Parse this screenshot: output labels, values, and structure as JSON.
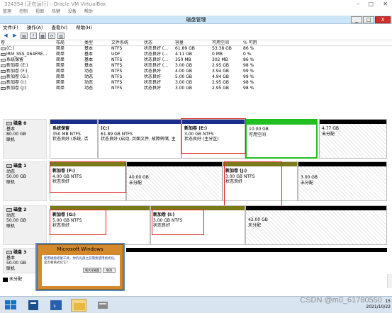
{
  "vbox": {
    "title": "324354 [正在运行] - Oracle VM VirtualBox",
    "menu": [
      "管理",
      "控制",
      "视图",
      "热键",
      "设备",
      "帮助"
    ]
  },
  "app": {
    "title": "磁盘管理",
    "controls": {
      "min": "_",
      "max": "□",
      "close": "X"
    },
    "menu": [
      "文件(F)",
      "操作(A)",
      "查看(V)",
      "帮助(H)"
    ]
  },
  "volume_table": {
    "headers": [
      "卷",
      "布局",
      "类型",
      "文件系统",
      "状态",
      "容量",
      "可用空间",
      "% 可用"
    ],
    "rows": [
      [
        "(C:)",
        "简单",
        "基本",
        "NTFS",
        "状态良好 (...",
        "61.89 GB",
        "53.38 GB",
        "86 %"
      ],
      [
        "IRM_SSS_X64FRE...",
        "简单",
        "基本",
        "UDF",
        "状态良好 (...",
        "4.11 GB",
        "0 MB",
        "0 %"
      ],
      [
        "系统保留",
        "简单",
        "基本",
        "NTFS",
        "状态良好 (...",
        "350 MB",
        "302 MB",
        "86 %"
      ],
      [
        "新加卷 (E:)",
        "简单",
        "基本",
        "NTFS",
        "状态良好 (...",
        "3.00 GB",
        "2.95 GB",
        "98 %"
      ],
      [
        "新加卷 (F:)",
        "简单",
        "动态",
        "NTFS",
        "状态良好",
        "4.00 GB",
        "3.94 GB",
        "99 %"
      ],
      [
        "新加卷 (G:)",
        "简单",
        "动态",
        "NTFS",
        "状态良好",
        "5.00 GB",
        "4.94 GB",
        "99 %"
      ],
      [
        "新加卷 (I:)",
        "简单",
        "动态",
        "NTFS",
        "状态良好",
        "3.00 GB",
        "2.95 GB",
        "98 %"
      ],
      [
        "新加卷 (J:)",
        "简单",
        "动态",
        "NTFS",
        "状态良好",
        "3.00 GB",
        "2.95 GB",
        "98 %"
      ]
    ]
  },
  "disks": [
    {
      "name": "磁盘 0",
      "type": "基本",
      "size": "80.00 GB",
      "status": "联机",
      "parts": [
        {
          "name": "系统保留",
          "line2": "350 MB NTFS",
          "line3": "状态良好 (系统, 活",
          "color": "#1a2f8c"
        },
        {
          "name": "(C:)",
          "line2": "61.89 GB NTFS",
          "line3": "状态良好 (启动, 页面文件, 故障转储, 主",
          "color": "#1a2f8c"
        },
        {
          "name": "新加卷 (E:)",
          "line2": "3.00 GB NTFS",
          "line3": "状态良好 (主分区)",
          "color": "#1a2f8c"
        },
        {
          "name": "",
          "line2": "10.00 GB",
          "line3": "可用空间",
          "color": "#20c020"
        },
        {
          "name": "",
          "line2": "4.77 GB",
          "line3": "未分配",
          "color": "#000000"
        }
      ]
    },
    {
      "name": "磁盘 1",
      "type": "动态",
      "size": "50.00 GB",
      "status": "联机",
      "parts": [
        {
          "name": "新加卷 (F:)",
          "line2": "4.00 GB NTFS",
          "line3": "状态良好",
          "color": "#7a7a1a"
        },
        {
          "name": "",
          "line2": "40.00 GB",
          "line3": "未分配",
          "color": "#000000"
        },
        {
          "name": "新加卷 (J:)",
          "line2": "3.00 GB NTFS",
          "line3": "状态良好",
          "color": "#7a7a1a"
        },
        {
          "name": "",
          "line2": "3.00 GB",
          "line3": "未分配",
          "color": "#000000"
        }
      ]
    },
    {
      "name": "磁盘 2",
      "type": "动态",
      "size": "50.00 GB",
      "status": "联机",
      "parts": [
        {
          "name": "新加卷 (G:)",
          "line2": "5.00 GB NTFS",
          "line3": "状态良好",
          "color": "#7a7a1a"
        },
        {
          "name": "新加卷 (I:)",
          "line2": "3.00 GB NTFS",
          "line3": "状态良好",
          "color": "#7a7a1a"
        },
        {
          "name": "",
          "line2": "42.00 GB",
          "line3": "未分配",
          "color": "#000000"
        }
      ]
    },
    {
      "name": "磁盘 3",
      "type": "基本",
      "size": "50.00 GB",
      "status": "联机",
      "parts": []
    }
  ],
  "legend": {
    "unallocated": "未分配"
  },
  "dialog": {
    "title": "Microsoft Windows",
    "line1": "使用磁盘修复工具，你的光盘之前需要使用格式化。",
    "line2": "是否要格式化它?",
    "btn_format": "格式化磁盘",
    "btn_cancel": "取消"
  },
  "watermark": "CSDN @m0_61780550",
  "clock": {
    "time": "15",
    "date": "2021/10/22"
  }
}
